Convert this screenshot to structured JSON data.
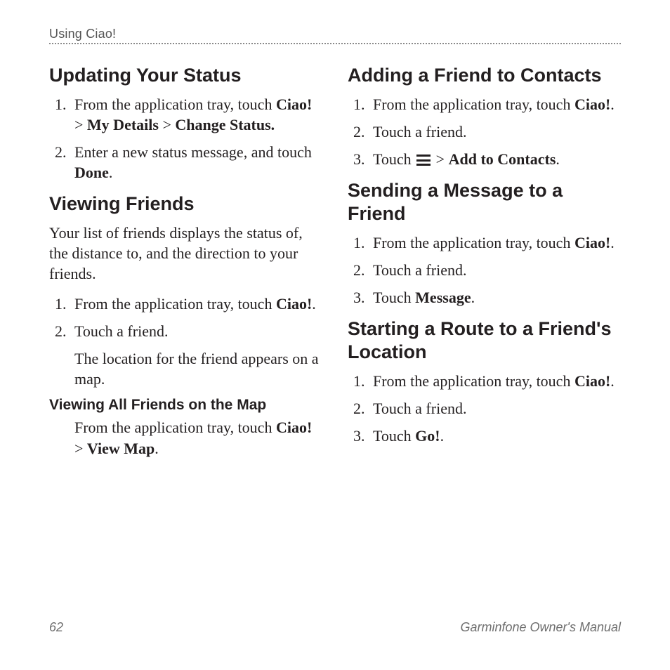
{
  "runningHead": "Using Ciao!",
  "footer": {
    "pageNumber": "62",
    "manualTitle": "Garminfone Owner's Manual"
  },
  "left": {
    "h_update": "Updating Your Status",
    "update_step1_a": "From the application tray, touch ",
    "update_step1_b1": "Ciao!",
    "update_step1_sep1": " > ",
    "update_step1_b2": "My Details",
    "update_step1_sep2": " > ",
    "update_step1_b3": "Change Status.",
    "update_step2_a": "Enter a new status message, and touch ",
    "update_step2_b": "Done",
    "update_step2_c": ".",
    "h_viewing": "Viewing Friends",
    "viewing_intro": "Your list of friends displays the status of, the distance to, and the direction to your friends.",
    "view_step1_a": "From the application tray, touch ",
    "view_step1_b": "Ciao!",
    "view_step1_c": ".",
    "view_step2_a": "Touch a friend.",
    "view_step2_note": "The location for the friend appears on a map.",
    "h_viewall": "Viewing All Friends on the Map",
    "viewall_a": "From the application tray, touch ",
    "viewall_b1": "Ciao!",
    "viewall_sep": " > ",
    "viewall_b2": "View Map",
    "viewall_c": "."
  },
  "right": {
    "h_addfriend": "Adding a Friend to Contacts",
    "add_step1_a": "From the application tray, touch ",
    "add_step1_b": "Ciao!",
    "add_step1_c": ".",
    "add_step2": "Touch a friend.",
    "add_step3_a": "Touch ",
    "add_step3_sep": " > ",
    "add_step3_b": "Add to Contacts",
    "add_step3_c": ".",
    "h_sendmsg": "Sending a Message to a Friend",
    "msg_step1_a": "From the application tray, touch ",
    "msg_step1_b": "Ciao!",
    "msg_step1_c": ".",
    "msg_step2": "Touch a friend.",
    "msg_step3_a": "Touch ",
    "msg_step3_b": "Message",
    "msg_step3_c": ".",
    "h_route": "Starting a Route to a Friend's Location",
    "route_step1_a": "From the application tray, touch ",
    "route_step1_b": "Ciao!",
    "route_step1_c": ".",
    "route_step2": "Touch a friend.",
    "route_step3_a": "Touch ",
    "route_step3_b": "Go!",
    "route_step3_c": "."
  }
}
